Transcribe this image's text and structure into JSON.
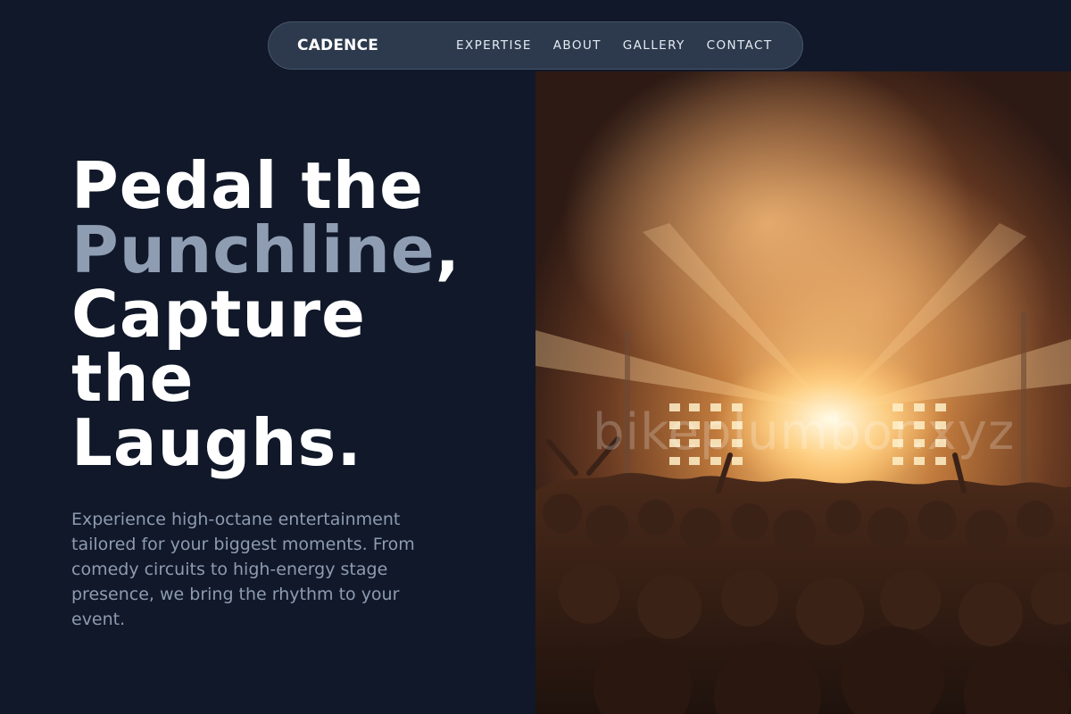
{
  "nav": {
    "brand": "CADENCE",
    "links": [
      "EXPERTISE",
      "ABOUT",
      "GALLERY",
      "CONTACT"
    ]
  },
  "hero": {
    "headline_part1": "Pedal the",
    "headline_accent": "Punchline",
    "headline_comma": ",",
    "headline_line3": "Capture",
    "headline_line4": "the",
    "headline_line5": "Laughs.",
    "description": "Experience high-octane entertainment tailored for your biggest moments. From comedy circuits to high-energy stage presence, we bring the rhythm to your event.",
    "image_watermark": "bikeplumbor.xyz"
  },
  "colors": {
    "background": "#101829",
    "accent_text": "#8f9db3",
    "nav_bg": "#2d3a4e"
  }
}
